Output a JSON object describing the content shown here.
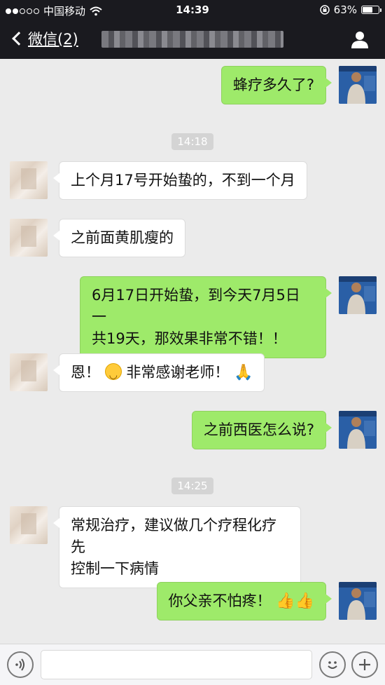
{
  "status_bar": {
    "carrier": "中国移动",
    "time": "14:39",
    "battery": "63%",
    "battery_level": 0.63
  },
  "nav": {
    "back_label": "微信(2)"
  },
  "messages": [
    {
      "side": "self",
      "text": "蜂疗多久了?"
    },
    {
      "timestamp": "14:18"
    },
    {
      "side": "other",
      "text": "上个月17号开始蛰的，不到一个月"
    },
    {
      "side": "other",
      "text": "之前面黄肌瘦的"
    },
    {
      "side": "self",
      "text_line1": "6月17日开始蛰，到今天7月5日一",
      "text_line2": "共19天，那效果非常不错！！"
    },
    {
      "side": "other",
      "text_before": "恩！",
      "text_after": "非常感谢老师！"
    },
    {
      "side": "self",
      "text": "之前西医怎么说?"
    },
    {
      "timestamp": "14:25"
    },
    {
      "side": "other",
      "text_line1": "常规治疗，建议做几个疗程化疗先",
      "text_line2": "控制一下病情"
    },
    {
      "side": "self",
      "text": "你父亲不怕疼！"
    }
  ],
  "icons": {
    "wifi": "wifi-icon",
    "lock": "orientation-lock-icon",
    "person": "person-icon",
    "voice": "voice-icon",
    "emoji": "emoji-icon",
    "plus": "plus-icon"
  },
  "colors": {
    "bubble_self": "#9eea6a",
    "bubble_other": "#ffffff",
    "chat_bg": "#ebebeb",
    "header_bg": "#1a1a1f"
  }
}
